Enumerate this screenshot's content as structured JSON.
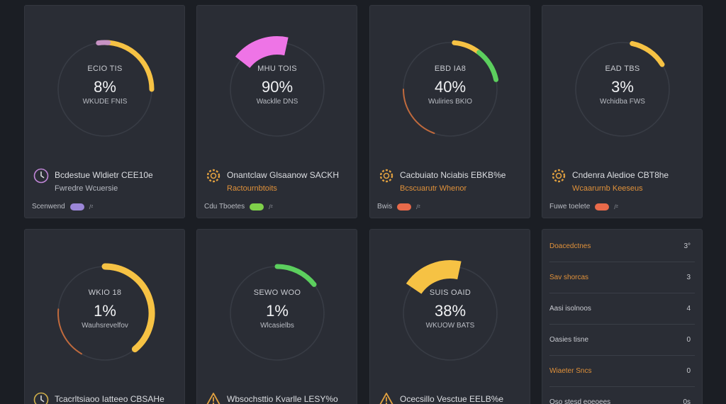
{
  "colors": {
    "background": "#1b1e24",
    "card": "#2a2d35",
    "ring": "#383c45",
    "yellow": "#f6c244",
    "green": "#5ccf5e",
    "pink": "#ee74e6",
    "orange": "#e0913a",
    "red": "#e86a4a",
    "purple": "#9b86d8"
  },
  "cards": [
    {
      "gauge": {
        "top": "ECIO TIS",
        "value": "8%",
        "sub": "WKUDE FNIS",
        "percent": 0.08,
        "arc_color": "#f6c244",
        "arc_style": "thin-yellow-head-pink"
      },
      "icon": "clock-icon",
      "icon_color": "#c186d8",
      "title": "Bcdestue Wldietr CEE10e",
      "sub": "Fwredre Wcuersie",
      "sub_color": "#b6b9c1",
      "footer": {
        "label": "Scenwend",
        "pill_color": "#9b86d8",
        "tail": "/²"
      }
    },
    {
      "gauge": {
        "top": "MHU TOIS",
        "value": "90%",
        "sub": "Wacklle DNS",
        "percent": 0.9,
        "arc_color": "#ee74e6",
        "arc_style": "thick"
      },
      "icon": "gear-icon",
      "icon_color": "#e0a040",
      "title": "Onantclaw Glsaanow SACKH",
      "sub": "Ractournbtoits",
      "sub_color": "#e0913a",
      "footer": {
        "label": "Cdu Tboetes",
        "pill_color": "#7fd04a",
        "tail": "/²"
      }
    },
    {
      "gauge": {
        "top": "EBD IA8",
        "value": "40%",
        "sub": "Wuliries BKIO",
        "percent": 0.4,
        "arc_color": "#f6c244",
        "arc_style": "thin-green"
      },
      "icon": "gear-icon",
      "icon_color": "#e0a040",
      "title": "Cacbuiato Nciabis EBKB%e",
      "sub": "Bcscuarutr Whenor",
      "sub_color": "#e0913a",
      "footer": {
        "label": "Bwis",
        "pill_color": "#e86a4a",
        "tail": "/²"
      }
    },
    {
      "gauge": {
        "top": "EAD TBS",
        "value": "3%",
        "sub": "Wchidba FWS",
        "percent": 0.03,
        "arc_color": "#f6c244",
        "arc_style": "thin"
      },
      "icon": "gear-icon",
      "icon_color": "#e0a040",
      "title": "Cndenra Aledioe CBT8he",
      "sub": "Wcaarurnb Keeseus",
      "sub_color": "#e0913a",
      "footer": {
        "label": "Fuwe toelete",
        "pill_color": "#e86a4a",
        "tail": "/²"
      }
    },
    {
      "gauge": {
        "top": "WKIO 18",
        "value": "1%",
        "sub": "Wauhsrevelfov",
        "percent": 0.01,
        "arc_color": "#f6c244",
        "arc_style": "thick-yellow"
      },
      "icon": "clock-icon",
      "icon_color": "#d1b04a",
      "title": "Tcacrltsiaoo Iatteeo CBSAHe",
      "sub": "",
      "sub_color": "#b6b9c1",
      "footer": null
    },
    {
      "gauge": {
        "top": "SEWO WOO",
        "value": "1%",
        "sub": "Wlcasielbs",
        "percent": 0.01,
        "arc_color": "#5ccf5e",
        "arc_style": "green"
      },
      "icon": "warning-icon",
      "icon_color": "#e0a040",
      "title": "Wbsochsttio Kvarlle LESY%o",
      "sub": "",
      "sub_color": "#b6b9c1",
      "footer": null
    },
    {
      "gauge": {
        "top": "SUIS OAID",
        "value": "38%",
        "sub": "WKUOW BATS",
        "percent": 0.38,
        "arc_color": "#f6c244",
        "arc_style": "thick-head"
      },
      "icon": "warning-icon",
      "icon_color": "#e0a040",
      "title": "Ocecsillo Vesctue EELB%e",
      "sub": "",
      "sub_color": "#b6b9c1",
      "footer": null
    }
  ],
  "list": [
    {
      "label": "Doacedctnes",
      "value": "3°",
      "color": "#e0913a"
    },
    {
      "label": "Sav shorcas",
      "value": "3",
      "color": "#e0913a"
    },
    {
      "label": "Aasi isolnoos",
      "value": "4",
      "color": "#c9cbd1"
    },
    {
      "label": "Oasies tisne",
      "value": "0",
      "color": "#c9cbd1"
    },
    {
      "label": "Wiaeter Sncs",
      "value": "0",
      "color": "#e0913a"
    },
    {
      "label": "Oso stesd eoeoees",
      "value": "0s",
      "color": "#c9cbd1"
    }
  ]
}
